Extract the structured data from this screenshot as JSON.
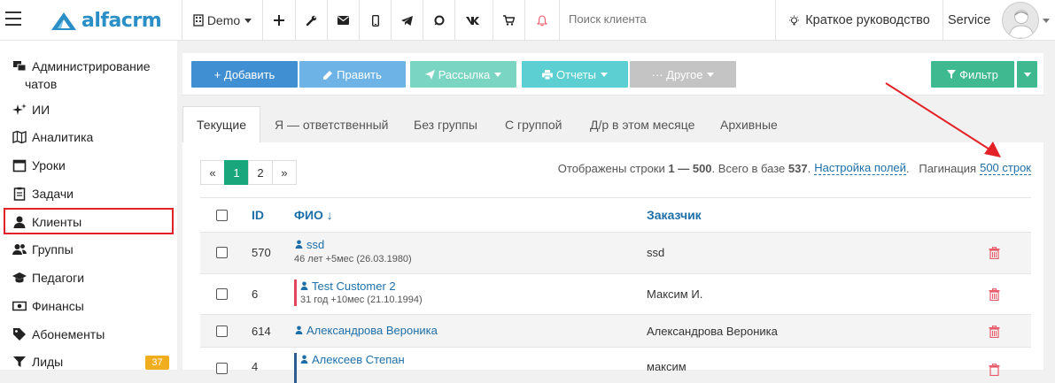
{
  "app": {
    "logo_text": "alfacrm",
    "brand_color": "#2a8fc6"
  },
  "topbar": {
    "branch": "Demo",
    "search_placeholder": "Поиск клиента",
    "guide_label": "Краткое руководство",
    "user_label": "Service",
    "icons": [
      "plus-icon",
      "wrench-icon",
      "envelope-icon",
      "mobile-icon",
      "telegram-icon",
      "whatsapp-icon",
      "vk-icon",
      "cart-icon",
      "bell-icon"
    ]
  },
  "sidebar": {
    "items": [
      {
        "label": "Администрирование чатов",
        "icon": "chat-admin-icon"
      },
      {
        "label": "ИИ",
        "icon": "sparkle-icon"
      },
      {
        "label": "Аналитика",
        "icon": "map-icon"
      },
      {
        "label": "Уроки",
        "icon": "calendar-icon"
      },
      {
        "label": "Задачи",
        "icon": "clipboard-icon"
      },
      {
        "label": "Клиенты",
        "icon": "user-icon"
      },
      {
        "label": "Группы",
        "icon": "users-icon"
      },
      {
        "label": "Педагоги",
        "icon": "graduation-cap-icon"
      },
      {
        "label": "Финансы",
        "icon": "money-icon"
      },
      {
        "label": "Абонементы",
        "icon": "tag-icon"
      },
      {
        "label": "Лиды",
        "icon": "funnel-icon"
      }
    ],
    "leads_badge": "37",
    "active_item": "Клиенты"
  },
  "toolbar": {
    "add": "+ Добавить",
    "edit": "Править",
    "mailing": "Рассылка",
    "reports": "Отчеты",
    "other": "··· Другое",
    "filter": "Фильтр",
    "colors": {
      "add": "#3f8fd2",
      "edit": "#6db3e6",
      "mailing": "#7ad5c2",
      "reports": "#5bcfd1",
      "other": "#c4c4c4",
      "filter": "#3fb98f"
    }
  },
  "tabs": [
    "Текущие",
    "Я — ответственный",
    "Без группы",
    "С группой",
    "Д/р в этом месяце",
    "Архивные"
  ],
  "pagination": {
    "prev": "«",
    "pages": [
      "1",
      "2"
    ],
    "next": "»",
    "current": "1",
    "info_prefix": "Отображены строки",
    "range": "1 — 500",
    "total_label": "Всего в базе",
    "total": "537",
    "fields_link": "Настройка полей",
    "pagination_label": "Пагинация",
    "per_page": "500 строк"
  },
  "table": {
    "columns": {
      "id": "ID",
      "name": "ФИО ↓",
      "customer": "Заказчик"
    },
    "rows": [
      {
        "id": "570",
        "name": "ssd",
        "sub": "46 лет +5мес (26.03.1980)",
        "customer": "ssd",
        "bar": ""
      },
      {
        "id": "6",
        "name": "Test Customer 2",
        "sub": "31 год +10мес (21.10.1994)",
        "customer": "Максим И.",
        "bar": "#e0475a"
      },
      {
        "id": "614",
        "name": "Александрова Вероника",
        "sub": "",
        "customer": "Александрова Вероника",
        "bar": ""
      },
      {
        "id": "4",
        "name": "Алексеев Степан",
        "sub": "",
        "customer": "максим",
        "bar": "#2f5c8f"
      }
    ]
  }
}
